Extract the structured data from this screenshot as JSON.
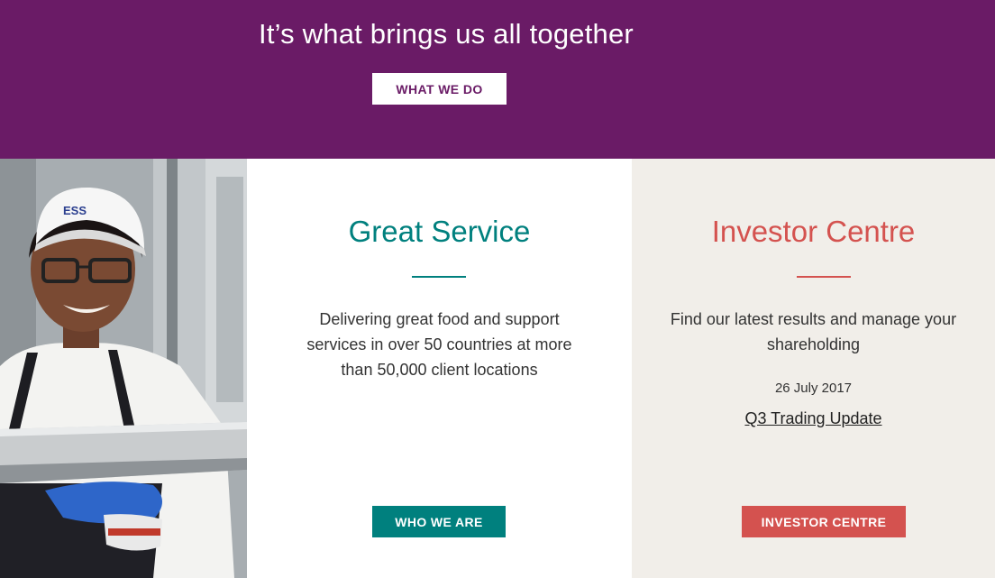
{
  "hero": {
    "title": "It’s what brings us all together",
    "button_label": "WHAT WE DO"
  },
  "service": {
    "title": "Great Service",
    "description": "Delivering great food and support services in over 50 countries at more than 50,000 client locations",
    "button_label": "WHO WE ARE"
  },
  "investor": {
    "title": "Investor Centre",
    "description": "Find our latest results and manage your shareholding",
    "date": "26 July 2017",
    "link_label": "Q3 Trading Update",
    "button_label": "INVESTOR CENTRE"
  },
  "photo": {
    "cap_logo": "ESS"
  },
  "colors": {
    "hero_bg": "#6a1b66",
    "service_accent": "#00807e",
    "investor_accent": "#d4524f",
    "investor_bg": "#f1eee9"
  }
}
